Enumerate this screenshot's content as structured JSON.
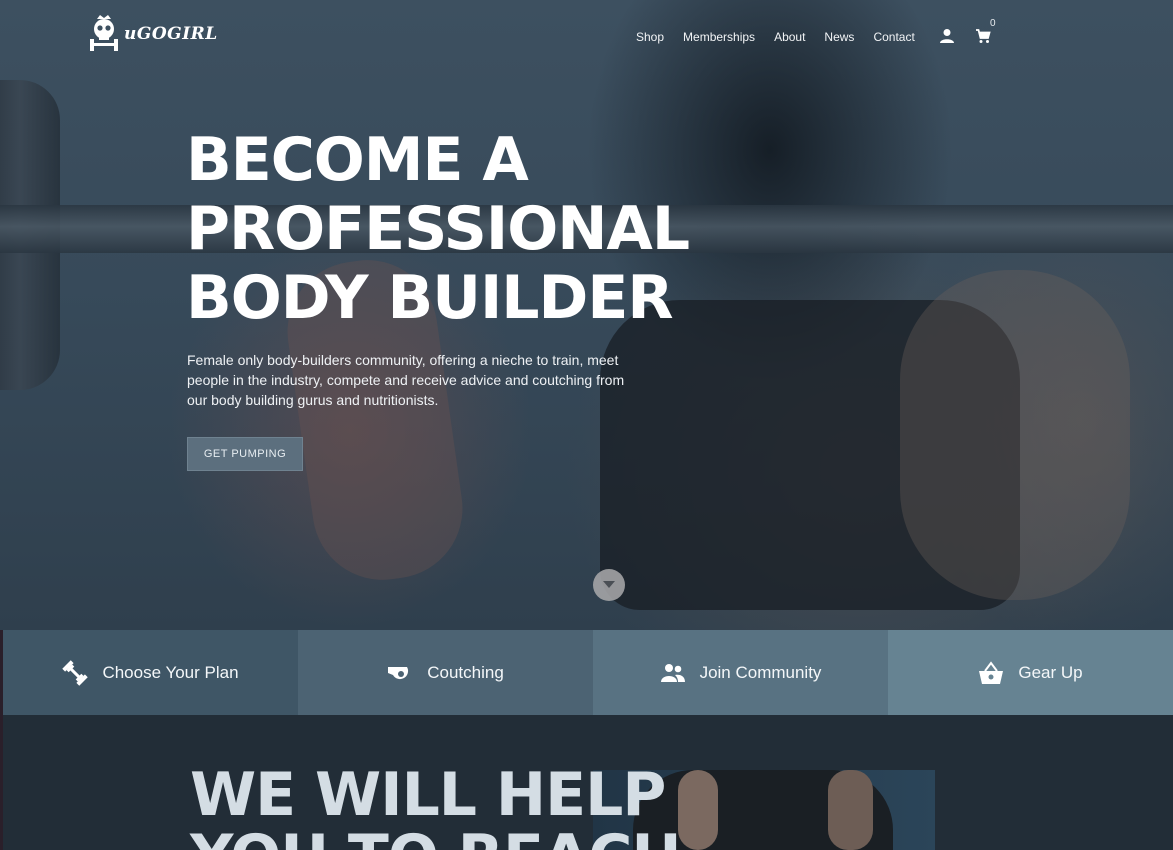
{
  "nav": {
    "brand": "uGOGIRL",
    "links": [
      "Shop",
      "Memberships",
      "About",
      "News",
      "Contact"
    ],
    "cart_count": "0",
    "icons": [
      "skull-dumbbell-logo-icon",
      "account-icon",
      "cart-icon"
    ]
  },
  "hero": {
    "headline": [
      "BECOME A",
      "PROFESSIONAL",
      "BODY BUILDER"
    ],
    "description": "Female only body-builders community, offering a nieche to train, meet people in the industry, compete and receive advice and coutching from our body building gurus and nutritionists.",
    "cta_label": "GET PUMPING",
    "scroll_icon": "chevron-down-icon"
  },
  "features": [
    {
      "label": "Choose Your Plan",
      "icon": "dumbbell-icon"
    },
    {
      "label": "Coutching",
      "icon": "whistle-icon"
    },
    {
      "label": "Join Community",
      "icon": "people-icon"
    },
    {
      "label": "Gear Up",
      "icon": "basket-icon"
    }
  ],
  "section": {
    "heading": [
      "WE WILL HELP",
      "YOU TO REACH"
    ]
  },
  "colors": {
    "feature_1": "#3f5666",
    "feature_2": "#4c6373",
    "feature_3": "#587282",
    "feature_4": "#668392",
    "cta": "#5c6f7e",
    "section_bg": "#222d37"
  }
}
